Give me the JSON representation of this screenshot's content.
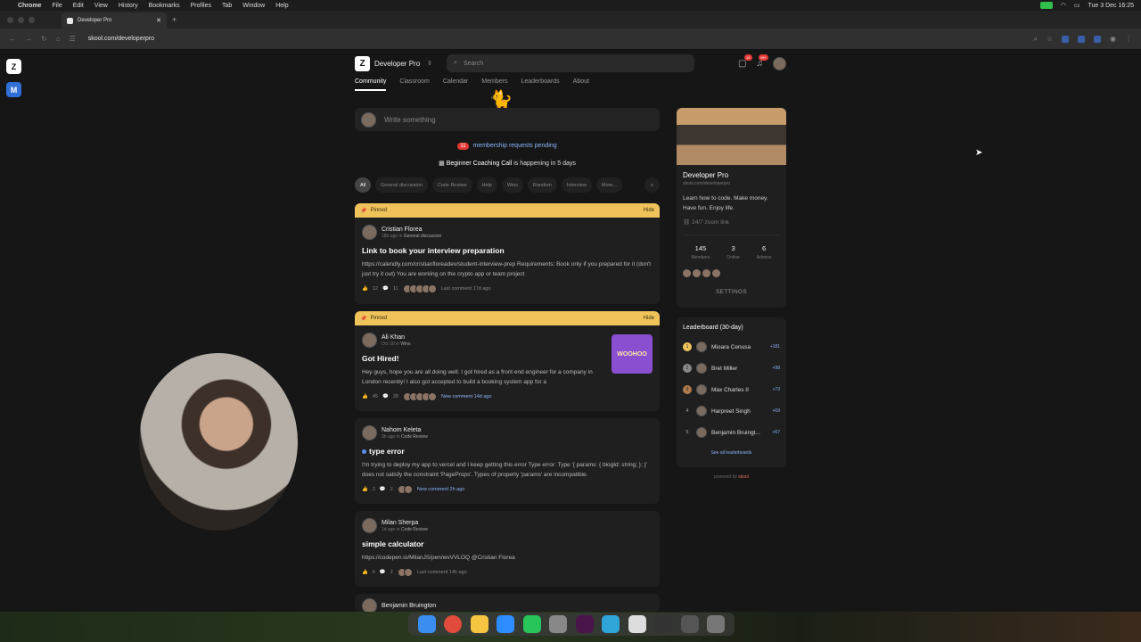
{
  "menubar": {
    "app": "Chrome",
    "items": [
      "File",
      "Edit",
      "View",
      "History",
      "Bookmarks",
      "Profiles",
      "Tab",
      "Window",
      "Help"
    ],
    "clock": "Tue 3 Dec  16:25"
  },
  "browser": {
    "tab_title": "Developer Pro",
    "url": "skool.com/developerpro"
  },
  "header": {
    "group_name": "Developer Pro",
    "search_placeholder": "Search",
    "chat_badge": "10",
    "notif_badge": "99+"
  },
  "nav": {
    "tabs": [
      "Community",
      "Classroom",
      "Calendar",
      "Members",
      "Leaderboards",
      "About"
    ]
  },
  "composer": {
    "placeholder": "Write something"
  },
  "pending": {
    "count": "11",
    "text": "membership requests pending"
  },
  "event": {
    "name": "Beginner Coaching Call",
    "text": "is happening in 5 days"
  },
  "filters": [
    "All",
    "General discussion",
    "Code Review",
    "Help",
    "Wins",
    "Random",
    "Interview",
    "More..."
  ],
  "posts": [
    {
      "pinned": "Pinned",
      "hide": "Hide",
      "author": "Cristian Florea",
      "meta": "18d ago  in ",
      "category": "General discussion",
      "title": "Link to book your interview preparation",
      "body": "https://calendly.com/cristianfloreadev/student-interview-prep Requirements: Book only if you prepared for it (don't just try it out) You are working on the crypto app or team project",
      "likes": "12",
      "comments": "11",
      "last": "Last comment 17d ago"
    },
    {
      "pinned": "Pinned",
      "hide": "Hide",
      "author": "Ali Khan",
      "meta": "Oct 30  in ",
      "category": "Wins",
      "title": "Got Hired!",
      "body": "Hey guys, hope you are all doing well. I got hired as a front end engineer for a company in London recently! I also got accepted to build a booking system app for a",
      "thumb": "WOOHOO",
      "likes": "45",
      "comments": "28",
      "last": "New comment 14d ago"
    },
    {
      "author": "Nahom Keleta",
      "meta": "3h ago  in ",
      "category": "Code Review",
      "title": "type error",
      "body": "I'm trying to deploy my app to vercel and I keep getting this error Type error: Type '{ params: { blogId: string; }; }' does not satisfy the constraint 'PageProps'. Types of property 'params' are incompatible.",
      "likes": "2",
      "comments": "2",
      "last": "New comment 2h ago"
    },
    {
      "author": "Milan Sherpa",
      "meta": "1d ago  in ",
      "category": "Code Review",
      "title": "simple calculator",
      "body": "https://codepen.io/MilanJS/pen/wvVVLOQ @Cristian Florea",
      "likes": "6",
      "comments": "2",
      "last": "Last comment 14h ago"
    },
    {
      "author": "Benjamin Bruington"
    }
  ],
  "sidebar": {
    "name": "Developer Pro",
    "url": "skool.com/developerpro",
    "description": "Learn how to code. Make money. Have fun. Enjoy life.",
    "link": "24/7 zoom link",
    "stats": [
      {
        "num": "145",
        "label": "Members"
      },
      {
        "num": "3",
        "label": "Online"
      },
      {
        "num": "6",
        "label": "Admins"
      }
    ],
    "settings": "SETTINGS"
  },
  "leaderboard": {
    "title": "Leaderboard (30-day)",
    "rows": [
      {
        "rank": "1",
        "name": "Mioara Cenusa",
        "pts": "+181"
      },
      {
        "rank": "2",
        "name": "Bret Miller",
        "pts": "+98"
      },
      {
        "rank": "3",
        "name": "Max Charles II",
        "pts": "+73"
      },
      {
        "rank": "4",
        "name": "Harpreet Singh",
        "pts": "+69"
      },
      {
        "rank": "5",
        "name": "Benjamin Bruingt...",
        "pts": "+67"
      }
    ],
    "see_all": "See all leaderboards"
  },
  "powered": {
    "prefix": "powered by",
    "brand": "skool"
  },
  "colors": {
    "pin": "#f0c35a",
    "link": "#8ab4f8",
    "badge": "#e53935"
  }
}
